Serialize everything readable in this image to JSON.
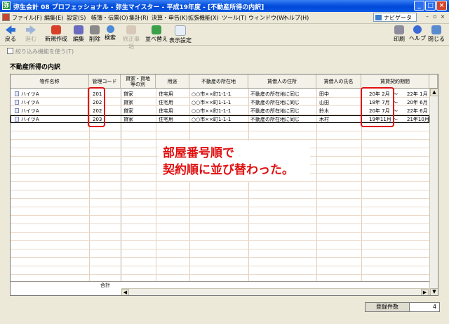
{
  "window": {
    "title": "弥生会計 08 プロフェッショナル - 弥生マイスター - 平成19年度 - [不動産所得の内訳]",
    "minimize": "_",
    "maximize": "□",
    "close": "×"
  },
  "menu": {
    "items": [
      "ファイル(F)",
      "編集(E)",
      "設定(S)",
      "帳簿・伝票(O)",
      "集計(R)",
      "決算・申告(K)",
      "拡張機能(X)",
      "ツール(T)",
      "ウィンドウ(W)",
      "ヘルプ(H)"
    ],
    "navi_label": "ナビゲータ"
  },
  "toolbar": {
    "back": "戻る",
    "forward": "進む",
    "new": "新規作成",
    "edit": "編集",
    "delete": "削除",
    "search": "検索",
    "correct": "修正事項",
    "sort": "並べ替え",
    "display": "表示設定",
    "print": "印刷",
    "help": "ヘルプ",
    "close": "閉じる"
  },
  "filter": {
    "label": "絞り込み機能を使う(T)"
  },
  "section_title": "不動産所得の内訳",
  "table": {
    "headers": {
      "name": "物件名称",
      "code": "管理コード",
      "type_l1": "貸家・貸地",
      "type_l2": "等の別",
      "use": "用途",
      "location": "不動産の所在地",
      "tenant_address": "賃借人の住所",
      "tenant_name": "賃借人の氏名",
      "period": "賃貸契約期間"
    },
    "rows": [
      {
        "name": "ハイツA",
        "code": "201",
        "type": "貸家",
        "use": "住宅用",
        "location": "○○市××町1-1-1",
        "tenant_address": "不動産の所在地に同じ",
        "tenant_name": "田中",
        "start": "20年 2月",
        "tilde": "～",
        "end": "22年 1月"
      },
      {
        "name": "ハイツA",
        "code": "202",
        "type": "貸家",
        "use": "住宅用",
        "location": "○○市××町1-1-1",
        "tenant_address": "不動産の所在地に同じ",
        "tenant_name": "山田",
        "start": "18年 7月",
        "tilde": "～",
        "end": "20年 6月"
      },
      {
        "name": "ハイツA",
        "code": "202",
        "type": "貸家",
        "use": "住宅用",
        "location": "○○市××町1-1-1",
        "tenant_address": "不動産の所在地に同じ",
        "tenant_name": "鈴木",
        "start": "20年 7月",
        "tilde": "～",
        "end": "22年 6月"
      },
      {
        "name": "ハイツA",
        "code": "203",
        "type": "貸家",
        "use": "住宅用",
        "location": "○○市××町1-1-1",
        "tenant_address": "不動産の所在地に同じ",
        "tenant_name": "木村",
        "start": "19年11月",
        "tilde": "～",
        "end": "21年10月"
      }
    ],
    "total_label": "合計"
  },
  "annotation": {
    "line1": "部屋番号順で",
    "line2": "契約順に並び替わった。",
    "color": "#e01010"
  },
  "status": {
    "count_label": "登録件数",
    "count_value": "4"
  }
}
